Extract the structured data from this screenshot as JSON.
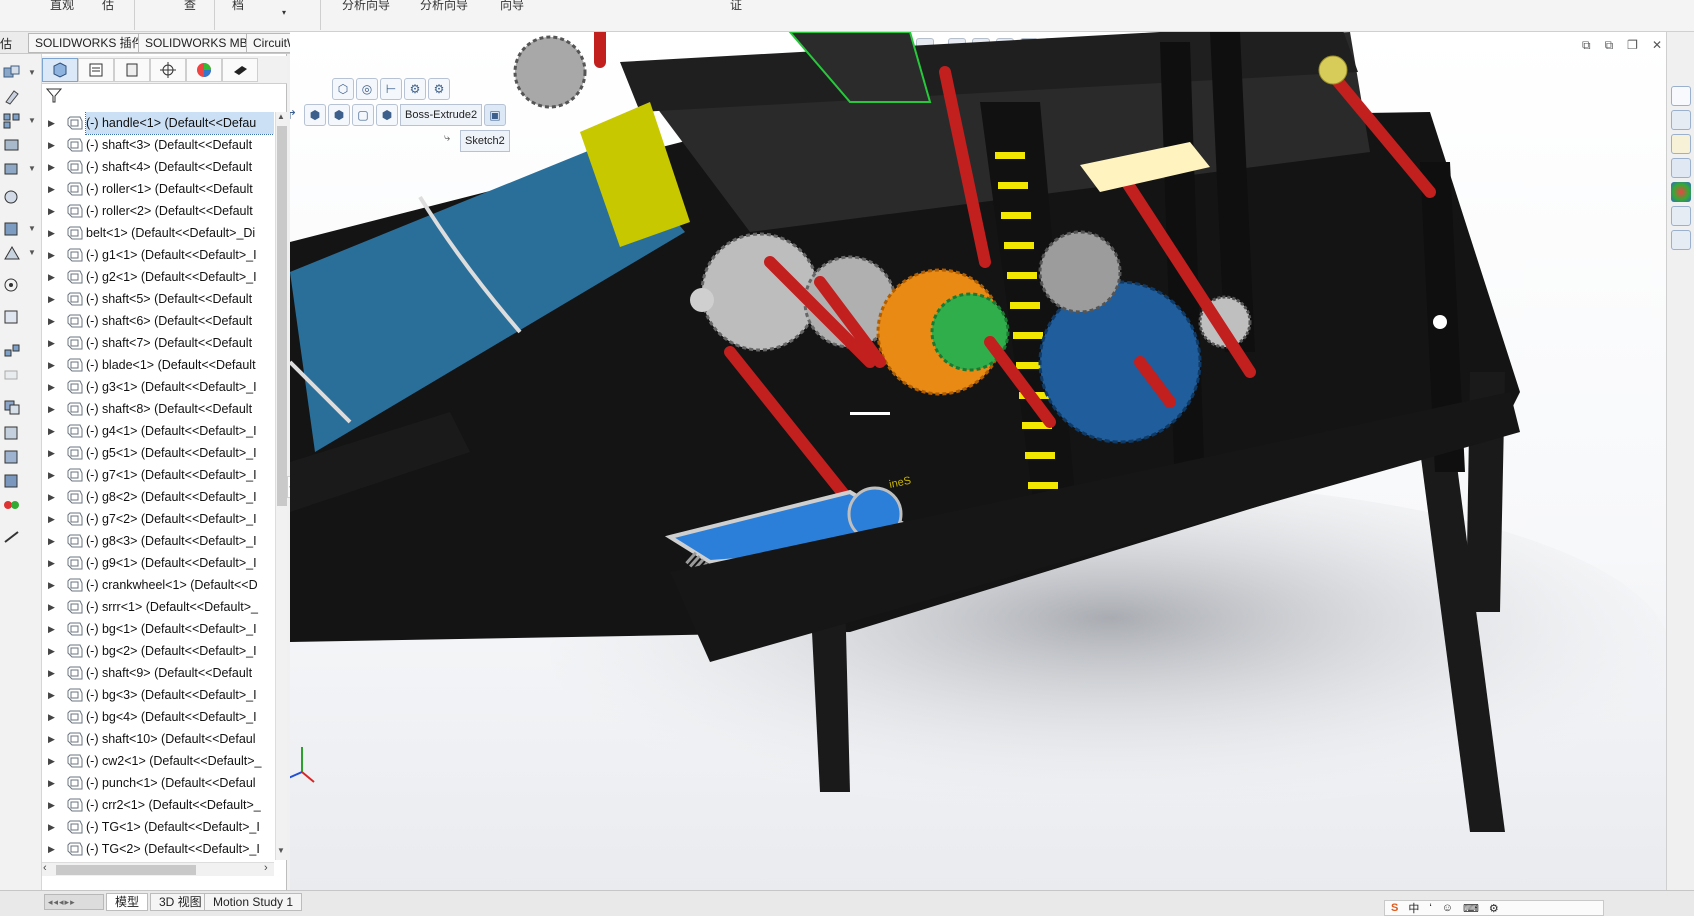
{
  "ribbon": {
    "items": [
      "直观",
      "估",
      "查",
      "档",
      "分析向导",
      "分析向导",
      "向导",
      "证"
    ]
  },
  "tabbar": {
    "lead": "估",
    "tabs": [
      "SOLIDWORKS 插件",
      "SOLIDWORKS MBD",
      "CircuitWorks"
    ]
  },
  "feature_tree": {
    "items": [
      {
        "label": "(-) handle<1> (Default<<Defau",
        "selected": true
      },
      {
        "label": "(-) shaft<3> (Default<<Default"
      },
      {
        "label": "(-) shaft<4> (Default<<Default"
      },
      {
        "label": "(-) roller<1> (Default<<Default"
      },
      {
        "label": "(-) roller<2> (Default<<Default"
      },
      {
        "label": "belt<1> (Default<<Default>_Di"
      },
      {
        "label": "(-) g1<1> (Default<<Default>_I"
      },
      {
        "label": "(-) g2<1> (Default<<Default>_I"
      },
      {
        "label": "(-) shaft<5> (Default<<Default"
      },
      {
        "label": "(-) shaft<6> (Default<<Default"
      },
      {
        "label": "(-) shaft<7> (Default<<Default"
      },
      {
        "label": "(-) blade<1> (Default<<Default"
      },
      {
        "label": "(-) g3<1> (Default<<Default>_I"
      },
      {
        "label": "(-) shaft<8> (Default<<Default"
      },
      {
        "label": "(-) g4<1> (Default<<Default>_I"
      },
      {
        "label": "(-) g5<1> (Default<<Default>_I"
      },
      {
        "label": "(-) g7<1> (Default<<Default>_I"
      },
      {
        "label": "(-) g8<2> (Default<<Default>_I"
      },
      {
        "label": "(-) g7<2> (Default<<Default>_I"
      },
      {
        "label": "(-) g8<3> (Default<<Default>_I"
      },
      {
        "label": "(-) g9<1> (Default<<Default>_I"
      },
      {
        "label": "(-) crankwheel<1> (Default<<D"
      },
      {
        "label": "(-) srrr<1> (Default<<Default>_"
      },
      {
        "label": "(-) bg<1> (Default<<Default>_I"
      },
      {
        "label": "(-) bg<2> (Default<<Default>_I"
      },
      {
        "label": "(-) shaft<9> (Default<<Default"
      },
      {
        "label": "(-) bg<3> (Default<<Default>_I"
      },
      {
        "label": "(-) bg<4> (Default<<Default>_I"
      },
      {
        "label": "(-) shaft<10> (Default<<Defaul"
      },
      {
        "label": "(-) cw2<1> (Default<<Default>_"
      },
      {
        "label": "(-) punch<1> (Default<<Defaul"
      },
      {
        "label": "(-) crr2<1> (Default<<Default>_"
      },
      {
        "label": "(-) TG<1> (Default<<Default>_I"
      },
      {
        "label": "(-) TG<2> (Default<<Default>_I"
      }
    ]
  },
  "breadcrumb": {
    "feature": "Boss-Extrude2",
    "sketch": "Sketch2"
  },
  "bottom_tabs": [
    "模型",
    "3D 视图",
    "Motion Study 1"
  ],
  "ime": {
    "items": [
      "中",
      "‘",
      "☺",
      "⌨",
      "⚙"
    ]
  },
  "colors": {
    "frame": "#161616",
    "conveyor": "#2a6f9a",
    "shaft": "#c21f1f",
    "gear_grey": "#b9b9b9",
    "gear_orange": "#e98a14",
    "gear_green": "#2fae4b",
    "gear_blue": "#1f5d9c",
    "rack_yellow": "#f2e700",
    "lime_band": "#c8c800",
    "handle_blue": "#2b7fd8"
  }
}
